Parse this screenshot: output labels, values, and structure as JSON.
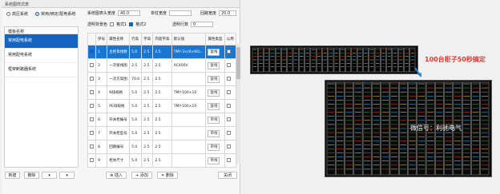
{
  "window": {
    "title": "系统图样式表"
  },
  "mode": {
    "options": [
      "高压系统",
      "常用/绑定/配电系统"
    ],
    "selected": 1
  },
  "left_panel": {
    "header": "模板名称",
    "items": [
      "常用配电系统",
      "常用配电系统",
      "框架断路器系统"
    ],
    "selected": 0
  },
  "settings": {
    "cabinet_width_label": "系统图表头宽度",
    "cabinet_width_value": "40.0",
    "row_height_label": "单柱宽度",
    "row_height_value": "",
    "loop_height_label": "回路宽度",
    "loop_height_value": "20.0",
    "style_label": "透明背景色",
    "style1_label": "格式1",
    "style2_label": "格式2",
    "circuit_count_label": "透明行数",
    "circuit_count_value": "0"
  },
  "table": {
    "headers": [
      "",
      "序号",
      "属性名称",
      "行高",
      "字高",
      "内容字高",
      "默认值",
      "属性类型",
      "公用"
    ],
    "rows": [
      {
        "no": "1",
        "name": "主柜母线数",
        "h": "5.0",
        "fh": "2.5",
        "ch": "2.5",
        "def": "TMY-3×(6×60)...",
        "type": "复线",
        "checked": true,
        "sel": true
      },
      {
        "no": "2",
        "name": "一次接线图",
        "h": "2.5",
        "fh": "2.5",
        "ch": "2.5",
        "def": "AC400V",
        "type": "复线",
        "checked": false,
        "sel": false
      },
      {
        "no": "3",
        "name": "一次方案图",
        "h": "70.0",
        "fh": "2.5",
        "ch": "2.5",
        "def": "",
        "type": "复线",
        "checked": false,
        "sel": false
      },
      {
        "no": "4",
        "name": "N排规格",
        "h": "5.0",
        "fh": "2.5",
        "ch": "2.5",
        "def": "TMY-100×10",
        "type": "复线",
        "checked": false,
        "sel": false
      },
      {
        "no": "5",
        "name": "PE排规格",
        "h": "5.0",
        "fh": "2.5",
        "ch": "2.5",
        "def": "TMY-100×10",
        "type": "复线",
        "checked": false,
        "sel": false
      },
      {
        "no": "6",
        "name": "开关柜编号",
        "h": "5.0",
        "fh": "2.5",
        "ch": "2.5",
        "def": "",
        "type": "单线",
        "checked": false,
        "sel": false
      },
      {
        "no": "7",
        "name": "开关柜型号",
        "h": "5.0",
        "fh": "2.5",
        "ch": "2.5",
        "def": "",
        "type": "单线",
        "checked": false,
        "sel": false
      },
      {
        "no": "8",
        "name": "回路编号",
        "h": "5.0",
        "fh": "2.5",
        "ch": "2.5",
        "def": "",
        "type": "单线",
        "checked": false,
        "sel": false
      },
      {
        "no": "9",
        "name": "柜体尺寸",
        "h": "5.0",
        "fh": "2.5",
        "ch": "2.5",
        "def": "",
        "type": "单线",
        "checked": false,
        "sel": false
      }
    ]
  },
  "buttons": {
    "new": "新建",
    "delete": "删除",
    "insert": "插入",
    "add": "添加",
    "remove": "删除",
    "close": "关闭"
  },
  "annotation": "100台柜子50秒搞定",
  "watermark": "微信号：利驰电气"
}
